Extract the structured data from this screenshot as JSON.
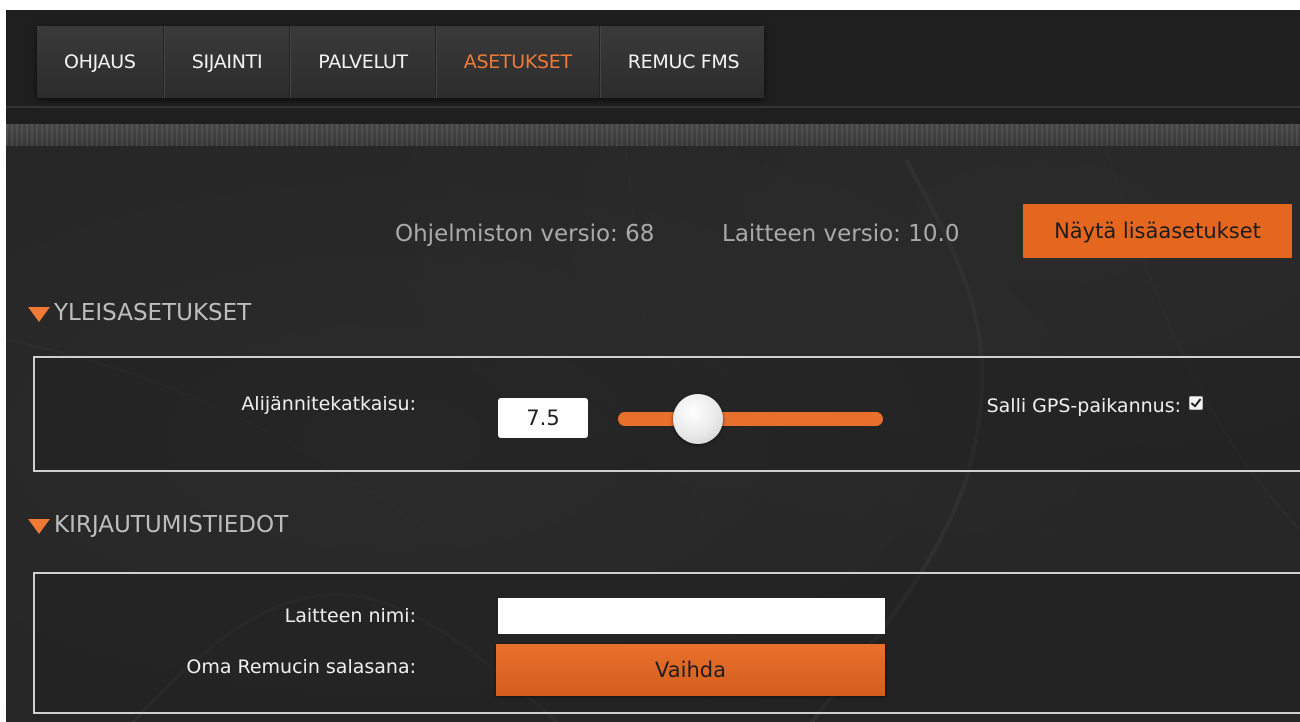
{
  "nav": {
    "items": [
      {
        "label": "OHJAUS",
        "active": false
      },
      {
        "label": "SIJAINTI",
        "active": false
      },
      {
        "label": "PALVELUT",
        "active": false
      },
      {
        "label": "ASETUKSET",
        "active": true
      },
      {
        "label": "REMUC FMS",
        "active": false
      }
    ]
  },
  "versions": {
    "software": "Ohjelmiston versio: 68",
    "device": "Laitteen versio: 10.0",
    "more_button": "Näytä lisäasetukset"
  },
  "general": {
    "title": "YLEISASETUKSET",
    "voltage_label": "Alijännitekatkaisu:",
    "voltage_value": "7.5",
    "gps_label": "Salli GPS-paikannus:",
    "gps_checked": true
  },
  "login": {
    "title": "KIRJAUTUMISTIEDOT",
    "device_name_label": "Laitteen nimi:",
    "device_name_value": "",
    "password_label": "Oma Remucin salasana:",
    "change_button": "Vaihda"
  },
  "colors": {
    "accent": "#f07a35",
    "button": "#e5661f",
    "background": "#262626"
  }
}
